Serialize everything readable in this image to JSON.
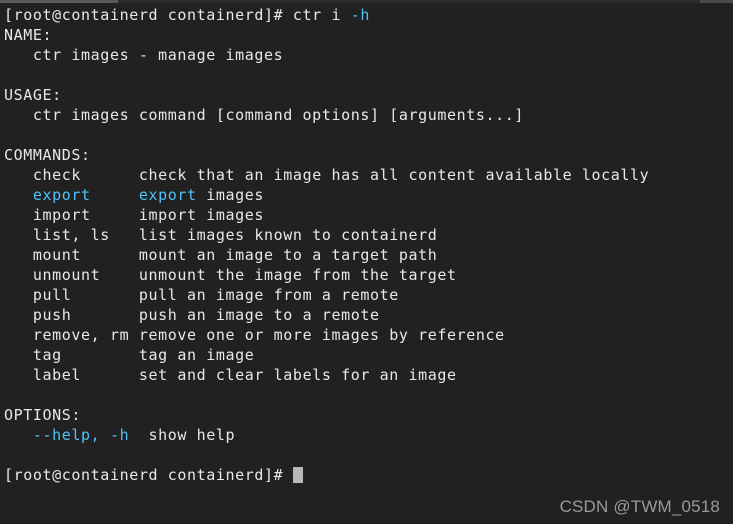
{
  "terminal": {
    "background_color": "#212121",
    "default_text_color": "#e8e8e8",
    "accent_color": "#4fc3f7",
    "cursor_color": "#b8b8b8"
  },
  "prompt": {
    "text": "[root@containerd containerd]# ctr i ",
    "typed_flag": "-h"
  },
  "sections": {
    "name_header": "NAME:",
    "name_body": "   ctr images - manage images",
    "usage_header": "USAGE:",
    "usage_body": "   ctr images command [command options] [arguments...]",
    "commands_header": "COMMANDS:",
    "options_header": "OPTIONS:"
  },
  "commands": [
    {
      "name": "   check      ",
      "name_color": "default",
      "desc": "check that an image has all content available locally"
    },
    {
      "name": "   export     ",
      "name_color": "cyan",
      "desc_accent": "export",
      "desc": " images"
    },
    {
      "name": "   import     ",
      "name_color": "default",
      "desc": "import images"
    },
    {
      "name": "   list, ls   ",
      "name_color": "default",
      "desc": "list images known to containerd"
    },
    {
      "name": "   mount      ",
      "name_color": "default",
      "desc": "mount an image to a target path"
    },
    {
      "name": "   unmount    ",
      "name_color": "default",
      "desc": "unmount the image from the target"
    },
    {
      "name": "   pull       ",
      "name_color": "default",
      "desc": "pull an image from a remote"
    },
    {
      "name": "   push       ",
      "name_color": "default",
      "desc": "push an image to a remote"
    },
    {
      "name": "   remove, rm ",
      "name_color": "default",
      "desc": "remove one or more images by reference"
    },
    {
      "name": "   tag        ",
      "name_color": "default",
      "desc": "tag an image"
    },
    {
      "name": "   label      ",
      "name_color": "default",
      "desc": "set and clear labels for an image"
    }
  ],
  "options": [
    {
      "flags": "   --help, -h",
      "desc": "  show help"
    }
  ],
  "final_prompt": {
    "text": "[root@containerd containerd]# "
  },
  "watermark": {
    "text": "CSDN @TWM_0518"
  }
}
